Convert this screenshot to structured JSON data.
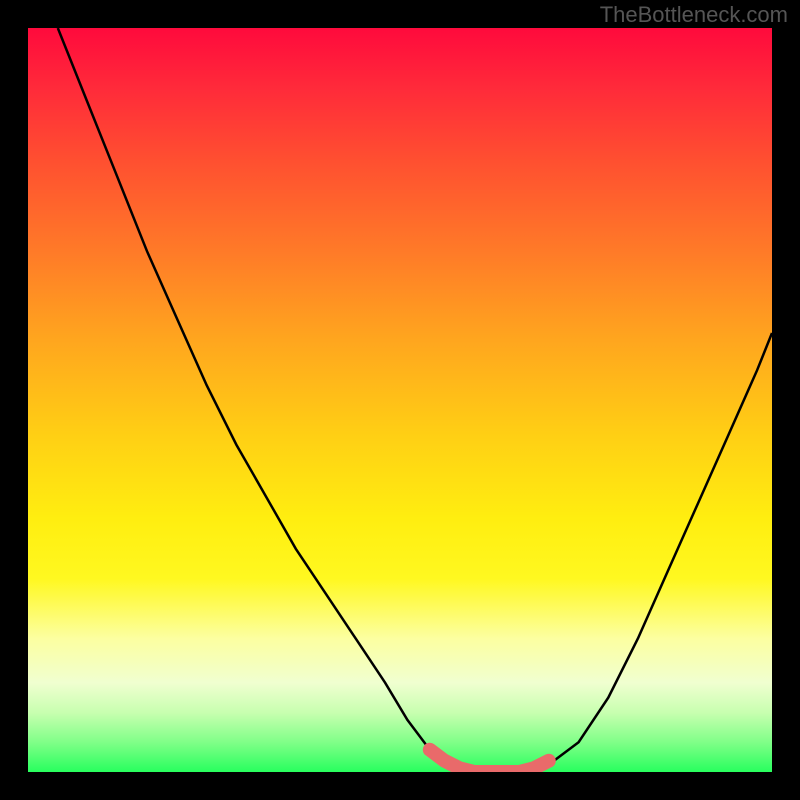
{
  "watermark": "TheBottleneck.com",
  "chart_data": {
    "type": "line",
    "title": "",
    "xlabel": "",
    "ylabel": "",
    "xlim": [
      0,
      100
    ],
    "ylim": [
      0,
      100
    ],
    "series": [
      {
        "name": "curve",
        "x": [
          4,
          8,
          12,
          16,
          20,
          24,
          28,
          32,
          36,
          40,
          44,
          48,
          51,
          54,
          57,
          60,
          62,
          66,
          70,
          74,
          78,
          82,
          86,
          90,
          94,
          98,
          100
        ],
        "y": [
          100,
          90,
          80,
          70,
          61,
          52,
          44,
          37,
          30,
          24,
          18,
          12,
          7,
          3,
          1,
          0,
          0,
          0,
          1,
          4,
          10,
          18,
          27,
          36,
          45,
          54,
          59
        ]
      },
      {
        "name": "trough-highlight",
        "x": [
          54,
          56,
          58,
          60,
          62,
          64,
          66,
          68,
          70
        ],
        "y": [
          3,
          1.5,
          0.5,
          0,
          0,
          0,
          0,
          0.5,
          1.5
        ]
      }
    ],
    "notes": "Gradient heat background from red (top) to green (bottom); black V-shaped curve with pink/red thick highlight at the minimum trough."
  }
}
